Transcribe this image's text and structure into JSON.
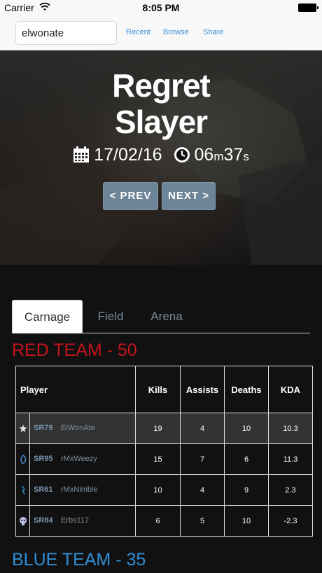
{
  "status_bar": {
    "carrier": "Carrier",
    "time": "8:05 PM"
  },
  "nav": {
    "search_value": "elwonate",
    "links": [
      "Recent",
      "Browse",
      "Share"
    ]
  },
  "game": {
    "title_line1": "Regret",
    "title_line2": "Slayer",
    "date": "17/02/16",
    "duration_min": "06",
    "duration_min_unit": "m",
    "duration_sec": "37",
    "duration_sec_unit": "s",
    "prev_label": "< PREV",
    "next_label": "NEXT >"
  },
  "tabs": [
    "Carnage",
    "Field",
    "Arena"
  ],
  "red_team": {
    "label": "RED TEAM - 50",
    "color": "#c4141b",
    "headers": [
      "Player",
      "Kills",
      "Assists",
      "Deaths",
      "KDA"
    ],
    "rows": [
      {
        "emblem": "star-emblem-icon",
        "rank": "SR79",
        "gamertag": "ElWonAte",
        "kills": "19",
        "assists": "4",
        "deaths": "10",
        "kda": "10.3"
      },
      {
        "emblem": "swirl-emblem-icon",
        "rank": "SR95",
        "gamertag": "rMxWeezy",
        "kills": "15",
        "assists": "7",
        "deaths": "6",
        "kda": "11.3"
      },
      {
        "emblem": "bolt-emblem-icon",
        "rank": "SR61",
        "gamertag": "rMxNimble",
        "kills": "10",
        "assists": "4",
        "deaths": "9",
        "kda": "2.3"
      },
      {
        "emblem": "skull-emblem-icon",
        "rank": "SR84",
        "gamertag": "Erbs117",
        "kills": "6",
        "assists": "5",
        "deaths": "10",
        "kda": "-2.3"
      }
    ]
  },
  "blue_team": {
    "label": "BLUE TEAM - 35",
    "color": "#2f8fd6"
  }
}
